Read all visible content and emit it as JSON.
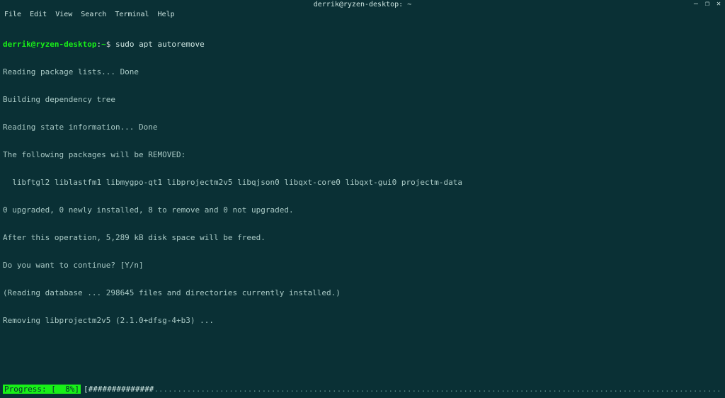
{
  "window": {
    "title": "derrik@ryzen-desktop: ~"
  },
  "menubar": {
    "items": [
      "File",
      "Edit",
      "View",
      "Search",
      "Terminal",
      "Help"
    ]
  },
  "prompt": {
    "user_host": "derrik@ryzen-desktop",
    "colon": ":",
    "path": "~",
    "dollar": "$ ",
    "command": "sudo apt autoremove"
  },
  "output": {
    "l1": "Reading package lists... Done",
    "l2": "Building dependency tree",
    "l3": "Reading state information... Done",
    "l4": "The following packages will be REMOVED:",
    "l5": "  libftgl2 liblastfm1 libmygpo-qt1 libprojectm2v5 libqjson0 libqxt-core0 libqxt-gui0 projectm-data",
    "l6": "0 upgraded, 0 newly installed, 8 to remove and 0 not upgraded.",
    "l7": "After this operation, 5,289 kB disk space will be freed.",
    "l8": "Do you want to continue? [Y/n]",
    "l9": "(Reading database ... 298645 files and directories currently installed.)",
    "l10": "Removing libprojectm2v5 (2.1.0+dfsg-4+b3) ..."
  },
  "progress": {
    "label": "Progress: [  8%]",
    "bar_open": " [",
    "hashes": "##############",
    "dots": "..........................................................................................................................................................................",
    "bar_close": "] "
  },
  "controls": {
    "minimize": "—",
    "maximize": "❐",
    "close": "✕"
  }
}
